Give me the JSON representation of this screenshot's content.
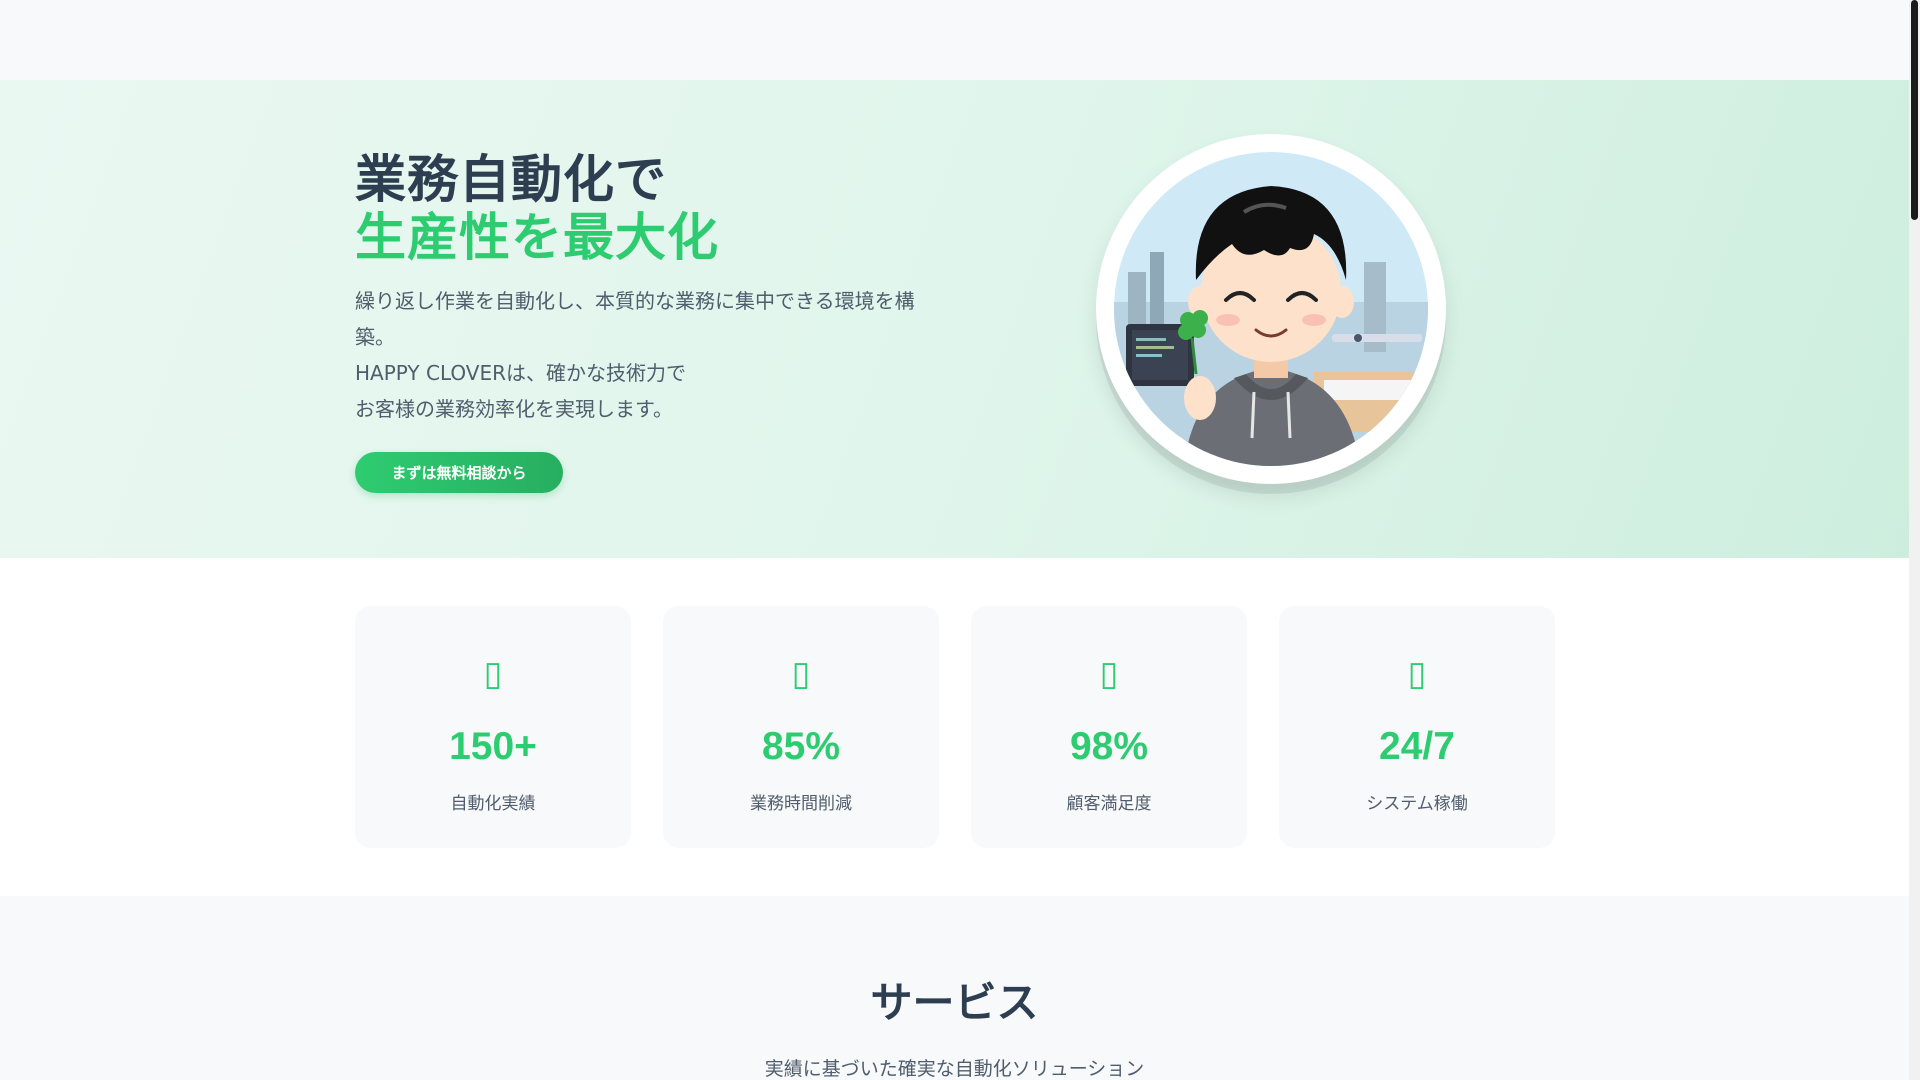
{
  "hero": {
    "title_line1": "業務自動化で",
    "title_line2": "生産性を最大化",
    "desc_line1": "繰り返し作業を自動化し、本質的な業務に集中できる環境を構築。",
    "desc_line2": "HAPPY CLOVERは、確かな技術力で",
    "desc_line3": "お客様の業務効率化を実現します。",
    "cta_label": "まずは無料相談から",
    "avatar_icon": "character-avatar-illustration"
  },
  "stats": [
    {
      "icon": "robot-icon",
      "value": "150+",
      "label": "自動化実績"
    },
    {
      "icon": "clock-icon",
      "value": "85%",
      "label": "業務時間削減"
    },
    {
      "icon": "smile-icon",
      "value": "98%",
      "label": "顧客満足度"
    },
    {
      "icon": "server-icon",
      "value": "24/7",
      "label": "システム稼働"
    }
  ],
  "services": {
    "title": "サービス",
    "subtitle": "実績に基づいた確実な自動化ソリューション"
  },
  "colors": {
    "accent": "#2ecc71",
    "heading": "#2c3e50",
    "text": "#4f5d6c",
    "hero_bg": "#dff5eb"
  }
}
